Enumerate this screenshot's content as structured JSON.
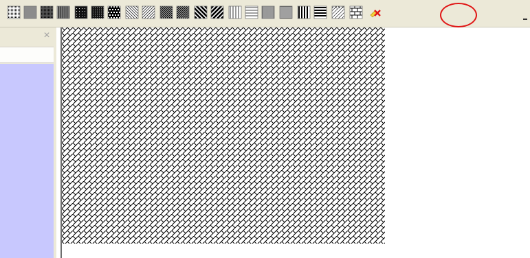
{
  "toolbar": {
    "buttons": [
      {
        "name": "pattern-dense-dots-50-button",
        "icon": "dots-50-percent-icon"
      },
      {
        "name": "pattern-solid-gray-button",
        "icon": "solid-gray-icon"
      },
      {
        "name": "pattern-dots-70-button",
        "icon": "dots-70-percent-icon"
      },
      {
        "name": "pattern-dots-75-button",
        "icon": "dots-75-percent-icon"
      },
      {
        "name": "pattern-dots-80-button",
        "icon": "dots-80-percent-icon"
      },
      {
        "name": "pattern-dots-90-button",
        "icon": "dots-90-percent-icon"
      },
      {
        "name": "pattern-large-checker-button",
        "icon": "large-checker-icon"
      },
      {
        "name": "pattern-light-downward-diagonal-button",
        "icon": "light-downward-diagonal-icon"
      },
      {
        "name": "pattern-light-upward-diagonal-button",
        "icon": "light-upward-diagonal-icon"
      },
      {
        "name": "pattern-dark-downward-diagonal-button",
        "icon": "dark-downward-diagonal-icon"
      },
      {
        "name": "pattern-dark-upward-diagonal-button",
        "icon": "dark-upward-diagonal-icon"
      },
      {
        "name": "pattern-wide-downward-diagonal-button",
        "icon": "wide-downward-diagonal-icon"
      },
      {
        "name": "pattern-wide-upward-diagonal-button",
        "icon": "wide-upward-diagonal-icon"
      },
      {
        "name": "pattern-light-vertical-button",
        "icon": "light-vertical-icon"
      },
      {
        "name": "pattern-light-horizontal-button",
        "icon": "light-horizontal-icon"
      },
      {
        "name": "pattern-narrow-vertical-button",
        "icon": "narrow-vertical-icon"
      },
      {
        "name": "pattern-narrow-horizontal-button",
        "icon": "narrow-horizontal-icon"
      },
      {
        "name": "pattern-dark-vertical-button",
        "icon": "dark-vertical-icon"
      },
      {
        "name": "pattern-dark-horizontal-button",
        "icon": "dark-horizontal-icon"
      },
      {
        "name": "pattern-diagonal-brick-button",
        "icon": "diagonal-brick-icon",
        "highlighted": true
      },
      {
        "name": "pattern-horizontal-brick-button",
        "icon": "horizontal-brick-icon"
      },
      {
        "name": "clear-pattern-button",
        "icon": "eraser-x-icon"
      }
    ],
    "highlight_color": "#e01515"
  },
  "side_pane": {
    "close_glyph": "×",
    "body_color": "#c8c8fe"
  },
  "canvas": {
    "fill_pattern": "diagonal-brick",
    "background": "#ffffff"
  }
}
